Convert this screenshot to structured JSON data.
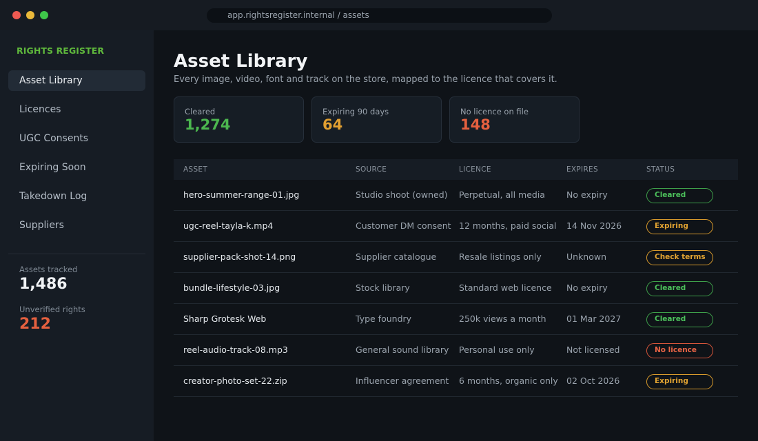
{
  "window": {
    "url": "app.rightsregister.internal / assets"
  },
  "sidebar": {
    "brand": "RIGHTS REGISTER",
    "items": [
      {
        "label": "Asset Library",
        "active": true
      },
      {
        "label": "Licences",
        "active": false
      },
      {
        "label": "UGC Consents",
        "active": false
      },
      {
        "label": "Expiring Soon",
        "active": false
      },
      {
        "label": "Takedown Log",
        "active": false
      },
      {
        "label": "Suppliers",
        "active": false
      }
    ],
    "stats": [
      {
        "label": "Assets tracked",
        "value": "1,486",
        "color": "#f0f2f5"
      },
      {
        "label": "Unverified rights",
        "value": "212",
        "color": "#e5603f"
      }
    ]
  },
  "main": {
    "title": "Asset Library",
    "subtitle": "Every image, video, font and track on the store, mapped to the licence that covers it.",
    "cards": [
      {
        "label": "Cleared",
        "value": "1,274",
        "color": "#4cb84f"
      },
      {
        "label": "Expiring 90 days",
        "value": "64",
        "color": "#e3a031"
      },
      {
        "label": "No licence on file",
        "value": "148",
        "color": "#e5603f"
      }
    ],
    "table": {
      "headers": {
        "asset": "ASSET",
        "source": "SOURCE",
        "licence": "LICENCE",
        "expires": "EXPIRES",
        "status": "STATUS"
      },
      "rows": [
        {
          "asset": "hero-summer-range-01.jpg",
          "source": "Studio shoot (owned)",
          "licence": "Perpetual, all media",
          "expires": "No expiry",
          "status": "Cleared",
          "kind": "cleared"
        },
        {
          "asset": "ugc-reel-tayla-k.mp4",
          "source": "Customer DM consent",
          "licence": "12 months, paid social",
          "expires": "14 Nov 2026",
          "status": "Expiring",
          "kind": "expiring"
        },
        {
          "asset": "supplier-pack-shot-14.png",
          "source": "Supplier catalogue",
          "licence": "Resale listings only",
          "expires": "Unknown",
          "status": "Check terms",
          "kind": "check"
        },
        {
          "asset": "bundle-lifestyle-03.jpg",
          "source": "Stock library",
          "licence": "Standard web licence",
          "expires": "No expiry",
          "status": "Cleared",
          "kind": "cleared"
        },
        {
          "asset": "Sharp Grotesk Web",
          "source": "Type foundry",
          "licence": "250k views a month",
          "expires": "01 Mar 2027",
          "status": "Cleared",
          "kind": "cleared"
        },
        {
          "asset": "reel-audio-track-08.mp3",
          "source": "General sound library",
          "licence": "Personal use only",
          "expires": "Not licensed",
          "status": "No licence",
          "kind": "none"
        },
        {
          "asset": "creator-photo-set-22.zip",
          "source": "Influencer agreement",
          "licence": "6 months, organic only",
          "expires": "02 Oct 2026",
          "status": "Expiring",
          "kind": "expiring"
        }
      ]
    }
  }
}
